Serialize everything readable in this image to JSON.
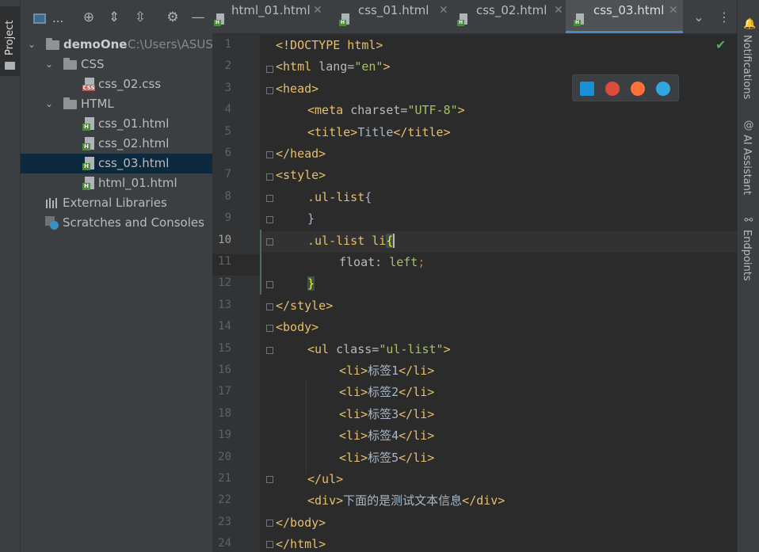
{
  "left_strip": {
    "project_label": "Project"
  },
  "project_panel": {
    "title_dots": "...",
    "tree": [
      {
        "label": "demoOne",
        "path": "C:\\Users\\ASUS",
        "kind": "folder",
        "expanded": true
      },
      {
        "label": "CSS",
        "kind": "folder",
        "expanded": true
      },
      {
        "label": "css_02.css",
        "kind": "css"
      },
      {
        "label": "HTML",
        "kind": "folder",
        "expanded": true
      },
      {
        "label": "css_01.html",
        "kind": "html"
      },
      {
        "label": "css_02.html",
        "kind": "html"
      },
      {
        "label": "css_03.html",
        "kind": "html",
        "selected": true
      },
      {
        "label": "html_01.html",
        "kind": "html"
      },
      {
        "label": "External Libraries",
        "kind": "library"
      },
      {
        "label": "Scratches and Consoles",
        "kind": "scratches"
      }
    ]
  },
  "tabs": [
    {
      "label": "html_01.html",
      "active": false
    },
    {
      "label": "css_01.html",
      "active": false
    },
    {
      "label": "css_02.html",
      "active": false
    },
    {
      "label": "css_03.html",
      "active": true
    }
  ],
  "right_strip": {
    "notifications": "Notifications",
    "ai_assistant": "AI Assistant",
    "endpoints": "Endpoints"
  },
  "editor": {
    "current_line": 10,
    "line_numbers": [
      "1",
      "2",
      "3",
      "4",
      "5",
      "6",
      "7",
      "8",
      "9",
      "10",
      "11",
      "12",
      "13",
      "14",
      "15",
      "16",
      "17",
      "18",
      "19",
      "20",
      "21",
      "22",
      "23",
      "24"
    ],
    "lines": {
      "l1": "<!DOCTYPE html>",
      "l2_tag_open": "<html ",
      "l2_attr": "lang=",
      "l2_val": "\"en\"",
      "l2_close": ">",
      "l3": "<head>",
      "l4_tag_open": "<meta ",
      "l4_attr": "charset=",
      "l4_val": "\"UTF-8\"",
      "l4_close": ">",
      "l5_open": "<title>",
      "l5_text": "Title",
      "l5_close": "</title>",
      "l6": "</head>",
      "l7": "<style>",
      "l8_sel": ".ul-list",
      "l8_brace": "{",
      "l9": "}",
      "l10_sel": ".ul-list li",
      "l10_brace": "{",
      "l11_prop": "float",
      "l11_colon": ": ",
      "l11_val": "left",
      "l11_semi": ";",
      "l12": "}",
      "l13": "</style>",
      "l14": "<body>",
      "l15_tag_open": "<ul ",
      "l15_attr": "class=",
      "l15_val": "\"ul-list\"",
      "l15_close": ">",
      "l16_open": "<li>",
      "l16_text": "标签1",
      "l16_close": "</li>",
      "l17_open": "<li>",
      "l17_text": "标签2",
      "l17_close": "</li>",
      "l18_open": "<li>",
      "l18_text": "标签3",
      "l18_close": "</li>",
      "l19_open": "<li>",
      "l19_text": "标签4",
      "l19_close": "</li>",
      "l20_open": "<li>",
      "l20_text": "标签5",
      "l20_close": "</li>",
      "l21": "</ul>",
      "l22_open": "<div>",
      "l22_text": "下面的是测试文本信息",
      "l22_close": "</div>",
      "l23": "</body>",
      "l24": "</html>"
    }
  },
  "browser_popup": [
    {
      "name": "webstorm",
      "color": "#1a8fd6"
    },
    {
      "name": "chrome",
      "color": "#dd4b39"
    },
    {
      "name": "firefox",
      "color": "#ff7139"
    },
    {
      "name": "edge",
      "color": "#2fa6e0"
    }
  ],
  "colors": {
    "accent": "#4a88c7",
    "tag": "#e8bf6a",
    "string": "#a5c261",
    "check": "#59a869"
  }
}
